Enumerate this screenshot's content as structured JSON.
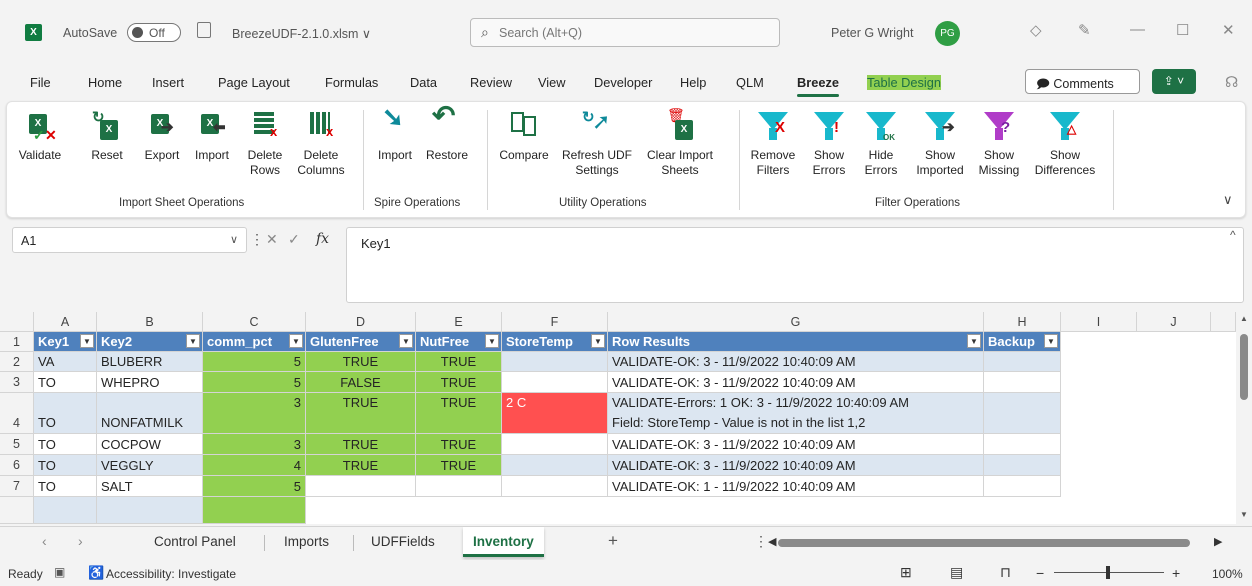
{
  "titlebar": {
    "logo": "X",
    "autosave_label": "AutoSave",
    "autosave_state": "Off",
    "filename": "BreezeUDF-2.1.0.xlsm ∨",
    "search_placeholder": "Search (Alt+Q)",
    "username": "Peter G Wright",
    "avatar": "PG"
  },
  "menu": {
    "items": [
      "File",
      "Home",
      "Insert",
      "Page Layout",
      "Formulas",
      "Data",
      "Review",
      "View",
      "Developer",
      "Help",
      "QLM",
      "Breeze",
      "Table Design"
    ],
    "comments_label": "Comments"
  },
  "ribbon": {
    "groups": {
      "import_sheet": "Import Sheet Operations",
      "spire": "Spire Operations",
      "utility": "Utility Operations",
      "filter": "Filter Operations"
    },
    "buttons": {
      "validate": "Validate",
      "reset": "Reset",
      "export": "Export",
      "import": "Import",
      "delete_rows_1": "Delete",
      "delete_rows_2": "Rows",
      "delete_cols_1": "Delete",
      "delete_cols_2": "Columns",
      "spire_import": "Import",
      "spire_restore": "Restore",
      "compare": "Compare",
      "refresh_1": "Refresh UDF",
      "refresh_2": "Settings",
      "clear_1": "Clear Import",
      "clear_2": "Sheets",
      "remove_1": "Remove",
      "remove_2": "Filters",
      "show_errors_1": "Show",
      "show_errors_2": "Errors",
      "hide_errors_1": "Hide",
      "hide_errors_2": "Errors",
      "show_imported_1": "Show",
      "show_imported_2": "Imported",
      "show_missing_1": "Show",
      "show_missing_2": "Missing",
      "show_diff_1": "Show",
      "show_diff_2": "Differences"
    }
  },
  "formula_bar": {
    "name_box": "A1",
    "formula": "Key1"
  },
  "grid": {
    "columns": [
      "A",
      "B",
      "C",
      "D",
      "E",
      "F",
      "G",
      "H",
      "I",
      "J"
    ],
    "headers": {
      "key1": "Key1",
      "key2": "Key2",
      "comm_pct": "comm_pct",
      "glutenfree": "GlutenFree",
      "nutfree": "NutFree",
      "storetemp": "StoreTemp",
      "rowresults": "Row Results",
      "backup": "Backup"
    },
    "rows": [
      {
        "n": "1"
      },
      {
        "n": "2",
        "key1": "VA",
        "key2": "BLUBERR",
        "comm": "5",
        "gf": "TRUE",
        "nf": "TRUE",
        "st": "",
        "result": "VALIDATE-OK: 3  -  11/9/2022 10:40:09 AM"
      },
      {
        "n": "3",
        "key1": "TO",
        "key2": "WHEPRO",
        "comm": "5",
        "gf": "FALSE",
        "nf": "TRUE",
        "st": "",
        "result": "VALIDATE-OK: 3  -  11/9/2022 10:40:09 AM"
      },
      {
        "n": "4",
        "key1": "TO",
        "key2": "NONFATMILK",
        "comm": "3",
        "gf": "TRUE",
        "nf": "TRUE",
        "st": "2 C",
        "result": "VALIDATE-Errors: 1 OK: 3  -  11/9/2022 10:40:09 AM",
        "result2": "Field: StoreTemp - Value is not in the list 1,2"
      },
      {
        "n": "5",
        "key1": "TO",
        "key2": "COCPOW",
        "comm": "3",
        "gf": "TRUE",
        "nf": "TRUE",
        "st": "",
        "result": "VALIDATE-OK: 3  -  11/9/2022 10:40:09 AM"
      },
      {
        "n": "6",
        "key1": "TO",
        "key2": "VEGGLY",
        "comm": "4",
        "gf": "TRUE",
        "nf": "TRUE",
        "st": "",
        "result": "VALIDATE-OK: 3  -  11/9/2022 10:40:09 AM"
      },
      {
        "n": "7",
        "key1": "TO",
        "key2": "SALT",
        "comm": "5",
        "gf": "",
        "nf": "",
        "st": "",
        "result": "VALIDATE-OK: 1  -  11/9/2022 10:40:09 AM"
      }
    ]
  },
  "sheets": {
    "tabs": [
      "Control Panel",
      "Imports",
      "UDFFields",
      "Inventory"
    ],
    "active": "Inventory",
    "add": "+"
  },
  "status": {
    "ready": "Ready",
    "accessibility": "Accessibility: Investigate",
    "zoom": "100%"
  },
  "colors": {
    "excel_green": "#1e7145",
    "table_header": "#4f81bd",
    "band": "#dce6f1",
    "valid_green": "#92d050",
    "error_red": "#ff5050"
  }
}
